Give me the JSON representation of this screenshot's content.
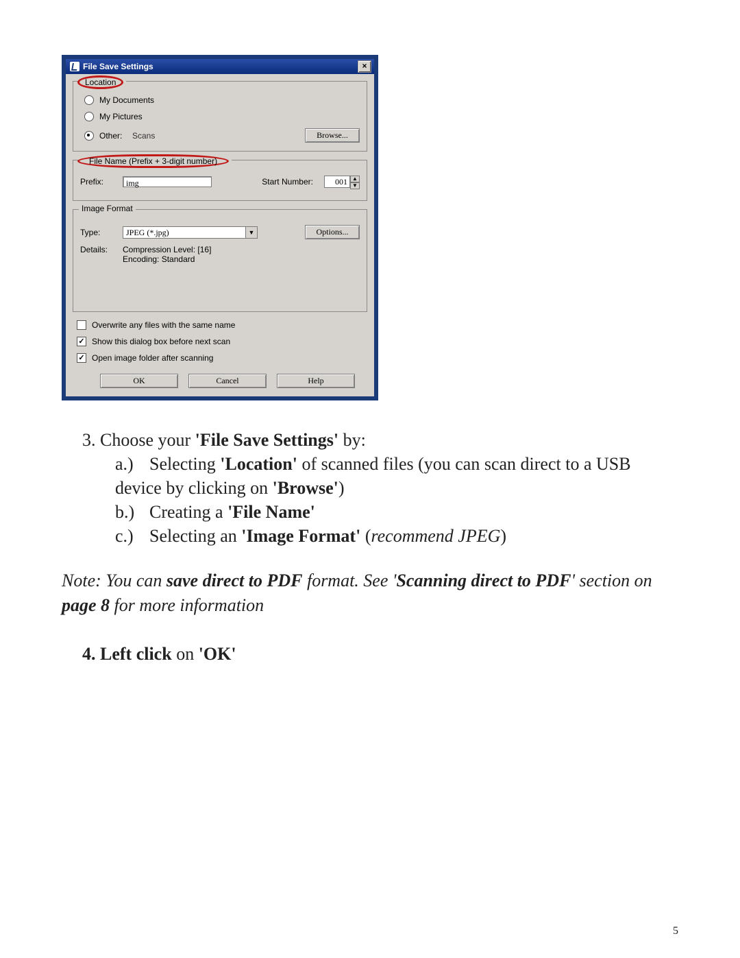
{
  "dialog": {
    "title": "File Save Settings",
    "close_glyph": "×",
    "location": {
      "legend": "Location",
      "my_documents": "My Documents",
      "my_pictures": "My Pictures",
      "other_label": "Other:",
      "other_value": "Scans",
      "browse": "Browse..."
    },
    "filename": {
      "legend": "File Name (Prefix + 3-digit number)",
      "prefix_label": "Prefix:",
      "prefix_value": "img",
      "start_label": "Start Number:",
      "start_value": "001"
    },
    "format": {
      "legend": "Image Format",
      "type_label": "Type:",
      "type_value": "JPEG (*.jpg)",
      "options": "Options...",
      "details_label": "Details:",
      "details_line1": "Compression Level: [16]",
      "details_line2": "Encoding: Standard"
    },
    "checks": {
      "overwrite": "Overwrite any files with the same name",
      "show_dialog": "Show this dialog box before next scan",
      "open_folder": "Open image folder after scanning"
    },
    "buttons": {
      "ok": "OK",
      "cancel": "Cancel",
      "help": "Help"
    }
  },
  "instructions": {
    "step3_prefix": "3. Choose your ",
    "step3_bold": "'File Save Settings'",
    "step3_suffix": " by:",
    "a_letter": "a.)",
    "a_t1": "Selecting ",
    "a_b1": "'Location'",
    "a_t2": " of scanned files (you can scan direct to a USB device by clicking on ",
    "a_b2": "'Browse'",
    "a_t3": ")",
    "b_letter": "b.)",
    "b_t1": "Creating a ",
    "b_b1": "'File Name'",
    "c_letter": "c.)",
    "c_t1": "Selecting an ",
    "c_b1": "'Image Format'",
    "c_t2": " (",
    "c_i1": "recommend JPEG",
    "c_t3": ")",
    "note_t1": "Note: You can ",
    "note_b1": "save direct to PDF",
    "note_t2": " format. See '",
    "note_b2": "Scanning direct to PDF",
    "note_t3": "' section on ",
    "note_b3": "page 8",
    "note_t4": " for more information",
    "step4_b1": "4. Left click",
    "step4_t1": " on ",
    "step4_b2": "'OK'"
  },
  "page_number": "5"
}
